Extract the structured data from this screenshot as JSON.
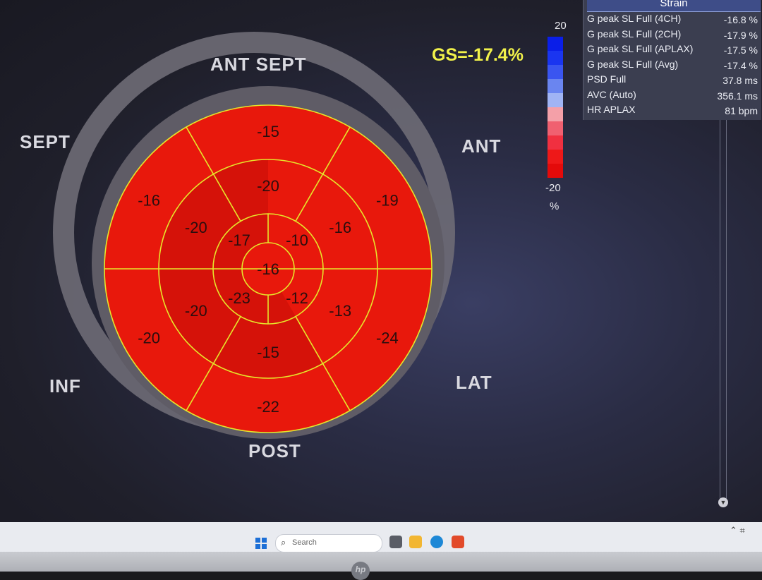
{
  "bullseye": {
    "global_strain": "GS=-17.4%",
    "wall_labels": {
      "ant_sept": "ANT  SEPT",
      "ant": "ANT",
      "lat": "LAT",
      "post": "POST",
      "inf": "INF",
      "sept": "SEPT"
    },
    "segments": {
      "basal": [
        "-15",
        "-19",
        "-24",
        "-22",
        "-20",
        "-16"
      ],
      "mid": [
        "-20",
        "-16",
        "-13",
        "-15",
        "-20",
        "-20"
      ],
      "apical": [
        "-10",
        "-12",
        "-23",
        "-17"
      ],
      "apex": "-16"
    },
    "colors": {
      "segment_fill": "#e8180c",
      "segment_dark": "#c40f08",
      "grid_line": "#e6e62a",
      "outer_ring": "#6e6b76"
    }
  },
  "color_scale": {
    "max_label": "20",
    "min_label": "-20",
    "unit": "%",
    "colors": [
      "#0a1ee8",
      "#1a35f0",
      "#3a55f0",
      "#6a85f0",
      "#a0b4f4",
      "#f4a0a8",
      "#f06070",
      "#f03040",
      "#ee1818",
      "#e40a0a"
    ]
  },
  "strain_panel": {
    "title": "Strain",
    "rows": [
      {
        "label": "G peak SL Full (4CH)",
        "value": "-16.8 %"
      },
      {
        "label": "G peak SL Full (2CH)",
        "value": "-17.9 %"
      },
      {
        "label": "G peak SL Full (APLAX)",
        "value": "-17.5 %"
      },
      {
        "label": "G peak SL Full (Avg)",
        "value": "-17.4 %"
      },
      {
        "label": "PSD Full",
        "value": "37.8 ms"
      },
      {
        "label": "AVC (Auto)",
        "value": "356.1 ms"
      },
      {
        "label": "HR APLAX",
        "value": "81 bpm"
      }
    ]
  },
  "taskbar": {
    "search_placeholder": "Search",
    "logo": "hp"
  }
}
